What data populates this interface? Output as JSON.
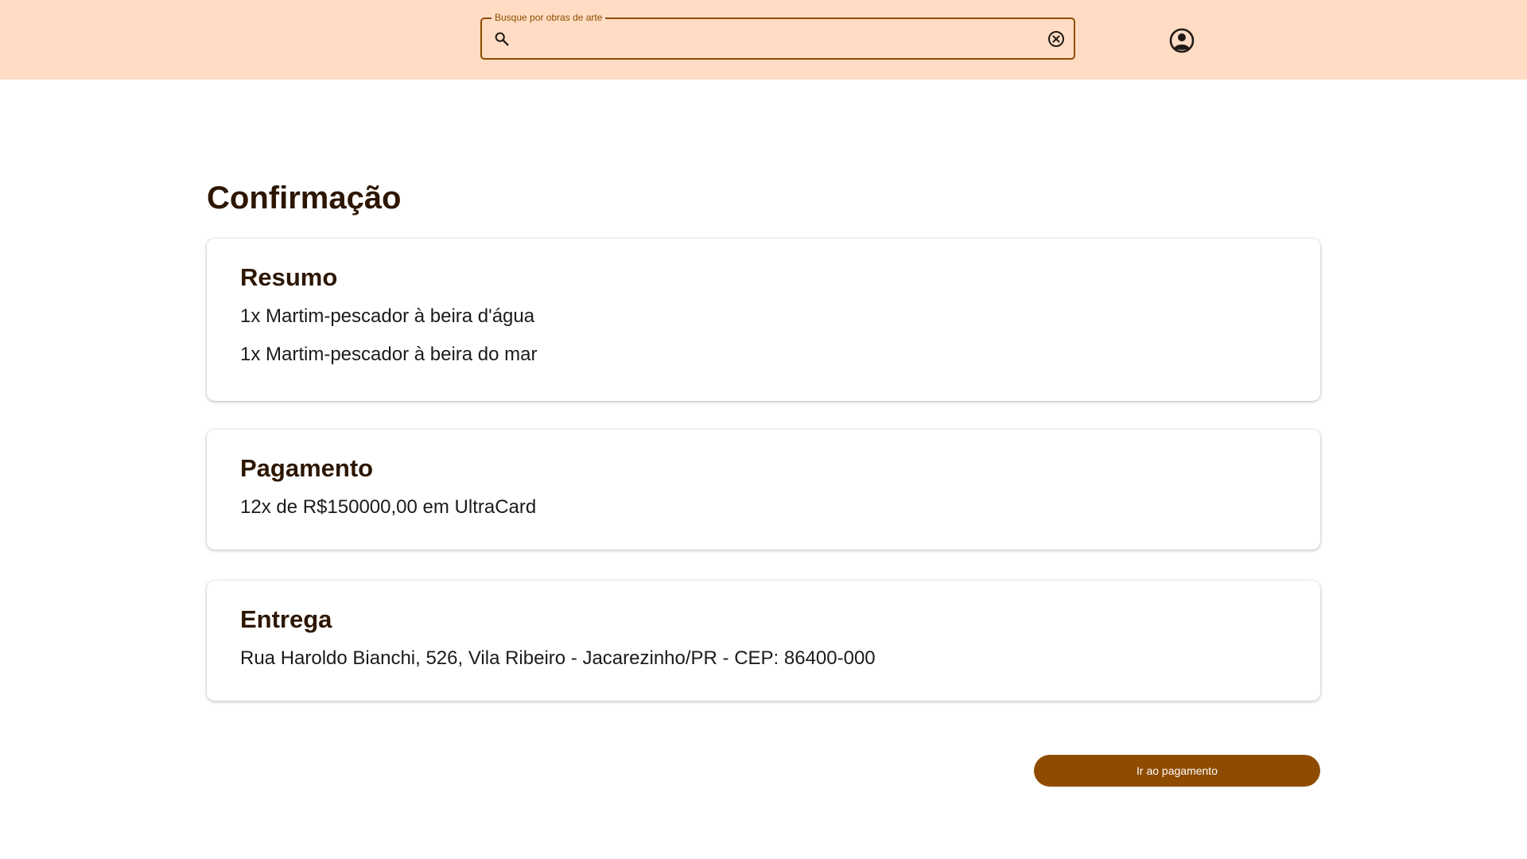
{
  "header": {
    "search": {
      "label": "Busque por obras de arte",
      "value": "",
      "placeholder": ""
    },
    "icons": {
      "search": "search-icon",
      "clear": "cancel-icon",
      "account": "account-circle-icon"
    }
  },
  "page": {
    "title": "Confirmação"
  },
  "summary": {
    "title": "Resumo",
    "items": [
      "1x Martim-pescador à beira d'água",
      "1x Martim-pescador à beira do mar"
    ]
  },
  "payment": {
    "title": "Pagamento",
    "text": "12x de R$150000,00 em UltraCard"
  },
  "delivery": {
    "title": "Entrega",
    "text": "Rua Haroldo Bianchi, 526, Vila Ribeiro - Jacarezinho/PR - CEP: 86400-000"
  },
  "actions": {
    "go_to_payment": "Ir ao pagamento"
  },
  "colors": {
    "topbar": "#ffdcc3",
    "accent": "#8f4c00",
    "heading": "#2d1600"
  }
}
